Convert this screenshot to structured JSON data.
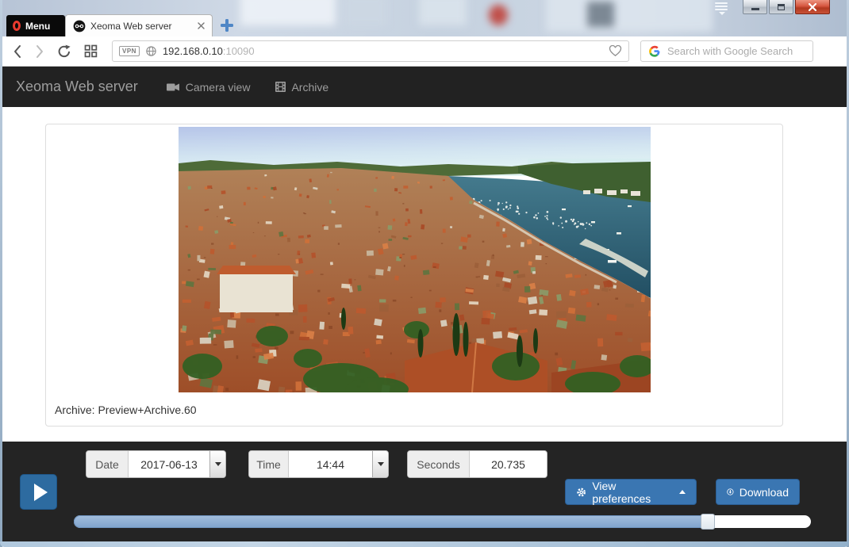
{
  "browser": {
    "menu_label": "Menu",
    "tab_title": "Xeoma Web server",
    "address": {
      "vpn": "VPN",
      "host": "192.168.0.10",
      "port": ":10090"
    },
    "search_placeholder": "Search with Google Search"
  },
  "navbar": {
    "brand": "Xeoma Web server",
    "camera_view": "Camera view",
    "archive": "Archive"
  },
  "content": {
    "caption": "Archive: Preview+Archive.60",
    "photo_alt": "Aerial view of a coastal town with terracotta roofs, a harbor with boats and a breakwater"
  },
  "footer": {
    "date": {
      "label": "Date",
      "value": "2017-06-13"
    },
    "time": {
      "label": "Time",
      "value": "14:44"
    },
    "seconds": {
      "label": "Seconds",
      "value": "20.735"
    },
    "view_preferences": "View preferences",
    "download": "Download",
    "slider": {
      "percent": 86
    }
  },
  "icons": {
    "window": [
      "tab-menu-chevron",
      "minimize",
      "maximize",
      "close"
    ],
    "toolbar": [
      "back",
      "forward",
      "reload",
      "speed-dial",
      "vpn-badge",
      "globe",
      "heart",
      "google-g"
    ],
    "nav": [
      "camera",
      "film-archive"
    ],
    "footer": [
      "play",
      "gear",
      "caret-up",
      "download-circle"
    ]
  },
  "colors": {
    "navbar_bg": "#222222",
    "footer_bg": "#242424",
    "accent_button": "#3a76b2",
    "slider_fill": "#8cadd6",
    "opera_red": "#ea3a2e"
  }
}
